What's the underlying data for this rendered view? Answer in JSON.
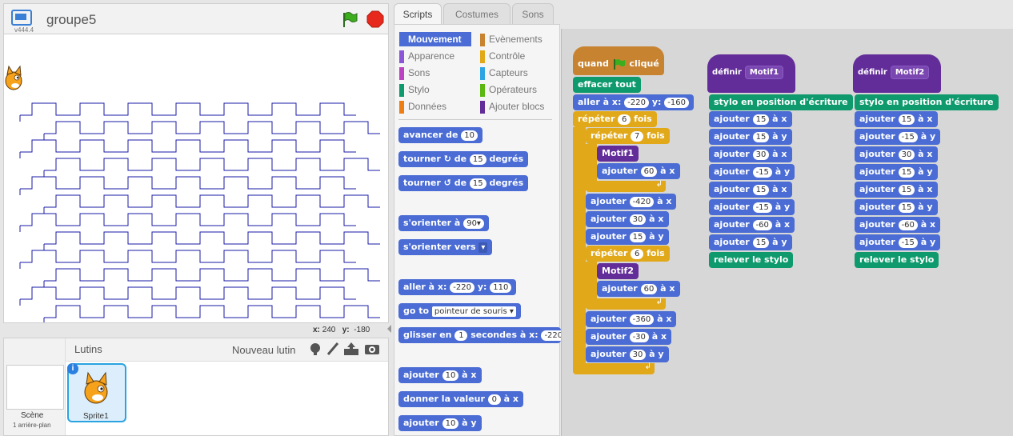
{
  "stage": {
    "title": "groupe5",
    "version": "v444.4",
    "x_label": "x:",
    "x_value": "240",
    "y_label": "y:",
    "y_value": "-180"
  },
  "sprites": {
    "header": "Lutins",
    "new_sprite": "Nouveau lutin",
    "scene_label": "Scène",
    "scene_backdrops": "1 arrière-plan",
    "sprite_name": "Sprite1"
  },
  "tabs": [
    "Scripts",
    "Costumes",
    "Sons"
  ],
  "categories_left": [
    {
      "label": "Mouvement",
      "color": "#4a6cd4"
    },
    {
      "label": "Apparence",
      "color": "#8a55d7"
    },
    {
      "label": "Sons",
      "color": "#bb42c3"
    },
    {
      "label": "Stylo",
      "color": "#0e9a6c"
    },
    {
      "label": "Données",
      "color": "#ee7d16"
    }
  ],
  "categories_right": [
    {
      "label": "Evènements",
      "color": "#c88330"
    },
    {
      "label": "Contrôle",
      "color": "#e1a91a"
    },
    {
      "label": "Capteurs",
      "color": "#2ca5e2"
    },
    {
      "label": "Opérateurs",
      "color": "#5cb712"
    },
    {
      "label": "Ajouter blocs",
      "color": "#632d99"
    }
  ],
  "palette": {
    "move": {
      "t1": "avancer de",
      "v1": "10"
    },
    "turn_right": {
      "t1": "tourner",
      "t2": "de",
      "v1": "15",
      "t3": "degrés"
    },
    "turn_left": {
      "t1": "tourner",
      "t2": "de",
      "v1": "15",
      "t3": "degrés"
    },
    "point_dir": {
      "t1": "s'orienter à",
      "v1": "90▾"
    },
    "point_towards": {
      "t1": "s'orienter vers",
      "v1": "▾"
    },
    "goto_xy": {
      "t1": "aller à x:",
      "v1": "-220",
      "t2": "y:",
      "v2": "110"
    },
    "goto": {
      "t1": "go to",
      "v1": "pointeur de souris ▾"
    },
    "glide": {
      "t1": "glisser en",
      "v1": "1",
      "t2": "secondes à x:",
      "v2": "-220"
    },
    "change_x": {
      "t1": "ajouter",
      "v1": "10",
      "t2": "à x"
    },
    "set_x": {
      "t1": "donner la valeur",
      "v1": "0",
      "t2": "à x"
    },
    "change_y": {
      "t1": "ajouter",
      "v1": "10",
      "t2": "à y"
    }
  },
  "script1": {
    "hat": {
      "t1": "quand",
      "t2": "cliqué"
    },
    "clear": "effacer tout",
    "goto": {
      "t1": "aller à x:",
      "v1": "-220",
      "t2": "y:",
      "v2": "-160"
    },
    "repeat1": {
      "t1": "répéter",
      "v1": "6",
      "t2": "fois"
    },
    "repeat2": {
      "t1": "répéter",
      "v1": "7",
      "t2": "fois"
    },
    "motif1": "Motif1",
    "add60x_a": {
      "t1": "ajouter",
      "v1": "60",
      "t2": "à x"
    },
    "add_m420x": {
      "t1": "ajouter",
      "v1": "-420",
      "t2": "à x"
    },
    "add30x": {
      "t1": "ajouter",
      "v1": "30",
      "t2": "à x"
    },
    "add15y": {
      "t1": "ajouter",
      "v1": "15",
      "t2": "à y"
    },
    "repeat3": {
      "t1": "répéter",
      "v1": "6",
      "t2": "fois"
    },
    "motif2": "Motif2",
    "add60x_b": {
      "t1": "ajouter",
      "v1": "60",
      "t2": "à x"
    },
    "add_m360x": {
      "t1": "ajouter",
      "v1": "-360",
      "t2": "à x"
    },
    "add_m30x": {
      "t1": "ajouter",
      "v1": "-30",
      "t2": "à x"
    },
    "add30y": {
      "t1": "ajouter",
      "v1": "30",
      "t2": "à y"
    }
  },
  "script2": {
    "def_label": "définir",
    "def_name": "Motif1",
    "pen_down": "stylo en position d'écriture",
    "steps": [
      {
        "t1": "ajouter",
        "v1": "15",
        "t2": "à x"
      },
      {
        "t1": "ajouter",
        "v1": "15",
        "t2": "à y"
      },
      {
        "t1": "ajouter",
        "v1": "30",
        "t2": "à x"
      },
      {
        "t1": "ajouter",
        "v1": "-15",
        "t2": "à y"
      },
      {
        "t1": "ajouter",
        "v1": "15",
        "t2": "à x"
      },
      {
        "t1": "ajouter",
        "v1": "-15",
        "t2": "à y"
      },
      {
        "t1": "ajouter",
        "v1": "-60",
        "t2": "à x"
      },
      {
        "t1": "ajouter",
        "v1": "15",
        "t2": "à y"
      }
    ],
    "pen_up": "relever le stylo"
  },
  "script3": {
    "def_label": "définir",
    "def_name": "Motif2",
    "pen_down": "stylo en position d'écriture",
    "steps": [
      {
        "t1": "ajouter",
        "v1": "15",
        "t2": "à x"
      },
      {
        "t1": "ajouter",
        "v1": "-15",
        "t2": "à y"
      },
      {
        "t1": "ajouter",
        "v1": "30",
        "t2": "à x"
      },
      {
        "t1": "ajouter",
        "v1": "15",
        "t2": "à y"
      },
      {
        "t1": "ajouter",
        "v1": "15",
        "t2": "à x"
      },
      {
        "t1": "ajouter",
        "v1": "15",
        "t2": "à y"
      },
      {
        "t1": "ajouter",
        "v1": "-60",
        "t2": "à x"
      },
      {
        "t1": "ajouter",
        "v1": "-15",
        "t2": "à y"
      }
    ],
    "pen_up": "relever le stylo"
  },
  "colors": {
    "motion": "#4a6cd4",
    "pen": "#0e9a6c",
    "control": "#e1a91a",
    "events": "#c88330",
    "more_blocks": "#632d99",
    "drawing": "#1a1aa6"
  },
  "icons": [
    "fullscreen-icon",
    "green-flag-icon",
    "stop-icon",
    "info-icon",
    "paint-brush-icon",
    "upload-icon",
    "camera-icon",
    "sprite-library-icon"
  ]
}
